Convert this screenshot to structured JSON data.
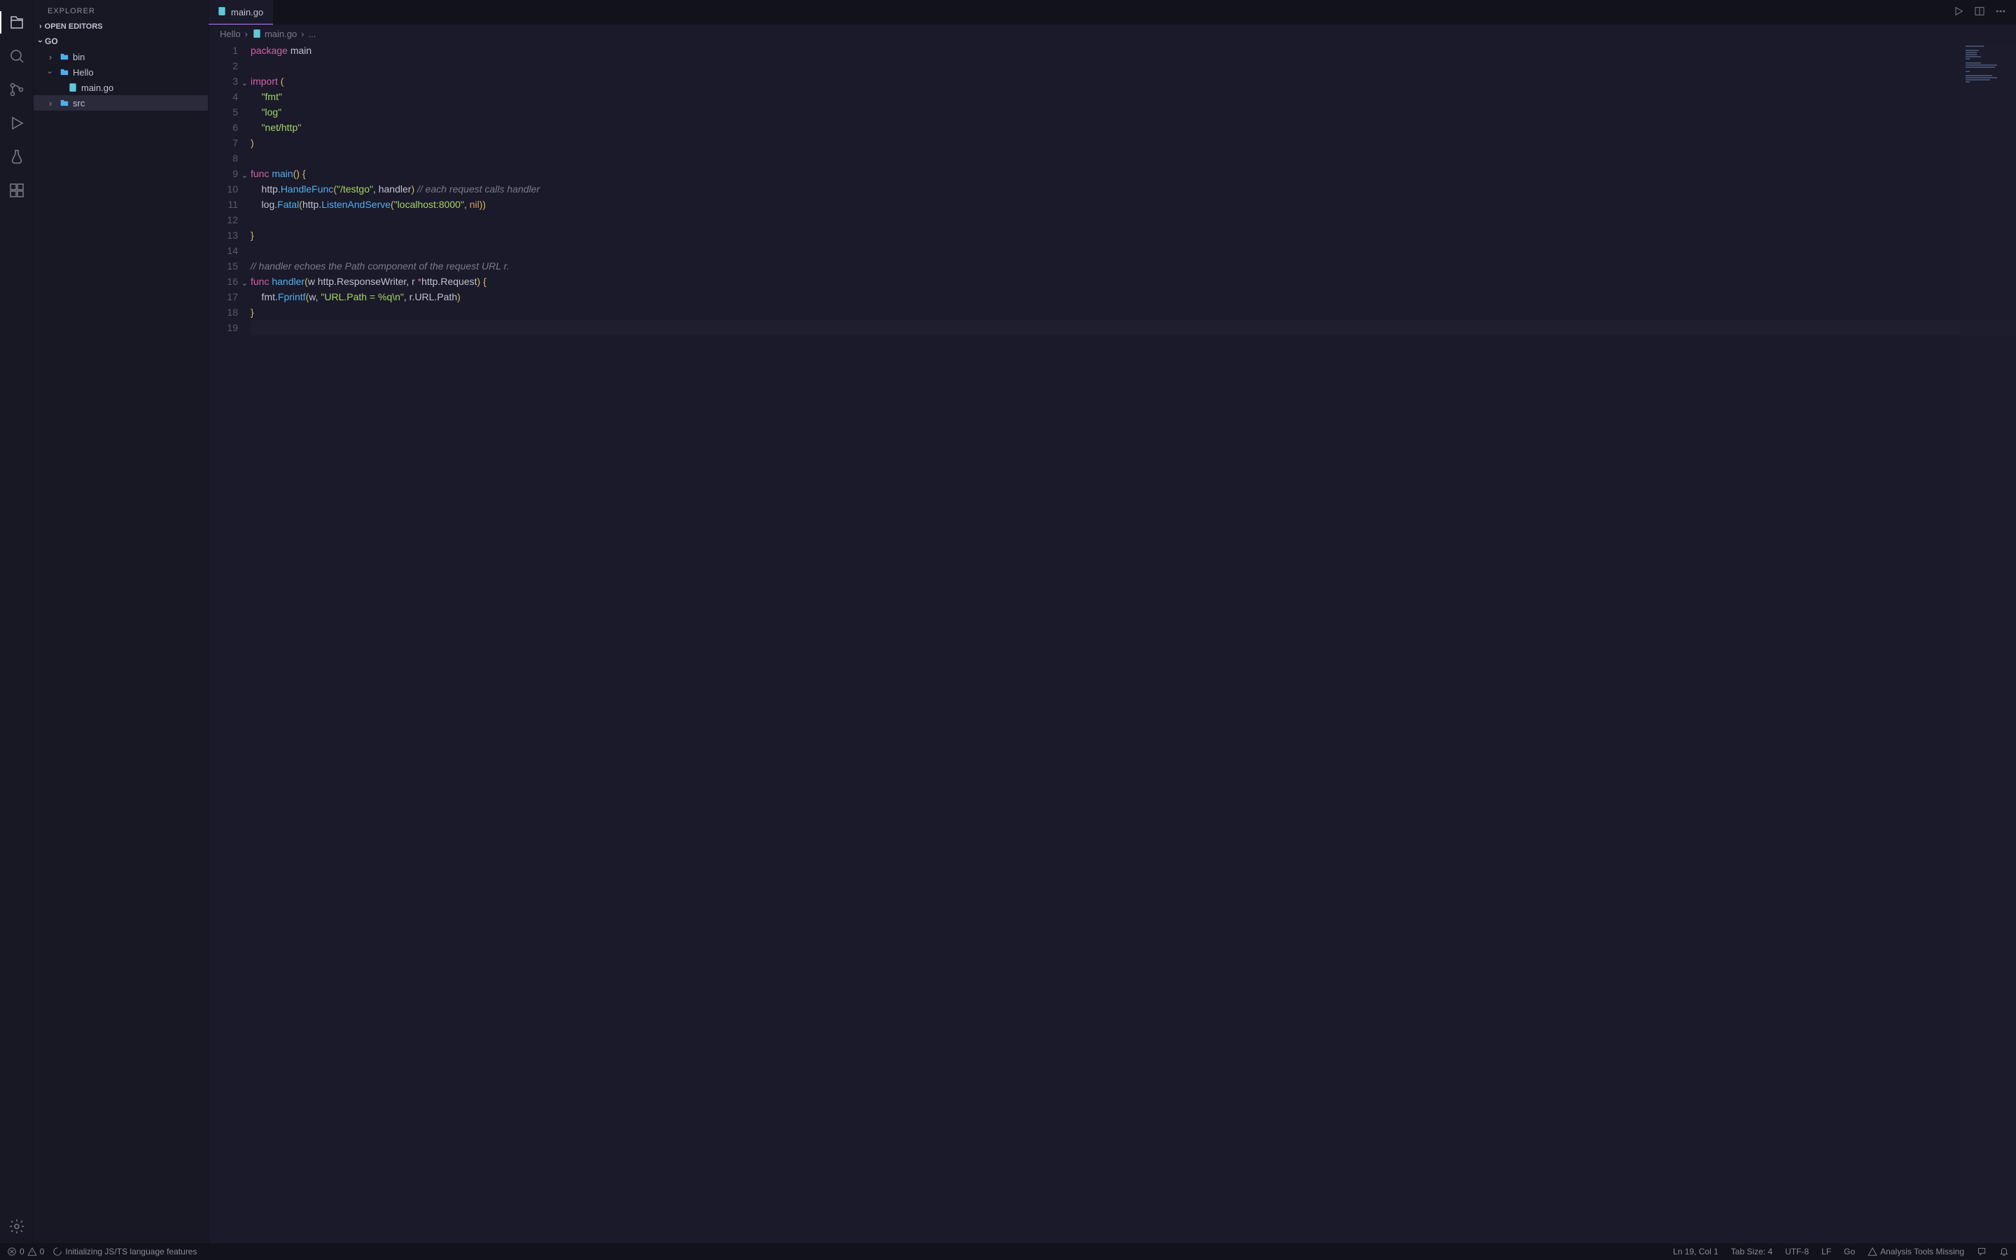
{
  "sidebar": {
    "title": "EXPLORER",
    "sections": {
      "open_editors": "OPEN EDITORS",
      "root": "GO"
    },
    "tree": [
      {
        "name": "bin",
        "type": "folder",
        "depth": 1,
        "expanded": false
      },
      {
        "name": "Hello",
        "type": "folder",
        "depth": 1,
        "expanded": true
      },
      {
        "name": "main.go",
        "type": "file",
        "depth": 2
      },
      {
        "name": "src",
        "type": "folder",
        "depth": 1,
        "expanded": false,
        "selected": true
      }
    ]
  },
  "tabs": {
    "active": "main.go"
  },
  "breadcrumbs": {
    "crumb1": "Hello",
    "crumb2": "main.go",
    "crumb3": "..."
  },
  "editor": {
    "lines": [
      {
        "n": 1,
        "tokens": [
          {
            "t": "package ",
            "c": "kw"
          },
          {
            "t": "main",
            "c": "pn"
          }
        ]
      },
      {
        "n": 2,
        "tokens": []
      },
      {
        "n": 3,
        "fold": true,
        "tokens": [
          {
            "t": "import ",
            "c": "kw"
          },
          {
            "t": "(",
            "c": "yl"
          }
        ]
      },
      {
        "n": 4,
        "tokens": [
          {
            "t": "    ",
            "c": ""
          },
          {
            "t": "\"fmt\"",
            "c": "str"
          }
        ]
      },
      {
        "n": 5,
        "tokens": [
          {
            "t": "    ",
            "c": ""
          },
          {
            "t": "\"log\"",
            "c": "str"
          }
        ]
      },
      {
        "n": 6,
        "tokens": [
          {
            "t": "    ",
            "c": ""
          },
          {
            "t": "\"net/http\"",
            "c": "str"
          }
        ]
      },
      {
        "n": 7,
        "tokens": [
          {
            "t": ")",
            "c": "yl"
          }
        ]
      },
      {
        "n": 8,
        "tokens": []
      },
      {
        "n": 9,
        "fold": true,
        "tokens": [
          {
            "t": "func ",
            "c": "kw"
          },
          {
            "t": "main",
            "c": "fn"
          },
          {
            "t": "()",
            "c": "yl"
          },
          {
            "t": " ",
            "c": ""
          },
          {
            "t": "{",
            "c": "yl"
          }
        ]
      },
      {
        "n": 10,
        "tokens": [
          {
            "t": "    http.",
            "c": "pn"
          },
          {
            "t": "HandleFunc",
            "c": "fn"
          },
          {
            "t": "(",
            "c": "yl"
          },
          {
            "t": "\"/testgo\"",
            "c": "str"
          },
          {
            "t": ", handler",
            "c": "pn"
          },
          {
            "t": ")",
            "c": "yl"
          },
          {
            "t": " ",
            "c": ""
          },
          {
            "t": "// each request calls handler",
            "c": "cmt"
          }
        ]
      },
      {
        "n": 11,
        "tokens": [
          {
            "t": "    log.",
            "c": "pn"
          },
          {
            "t": "Fatal",
            "c": "fn"
          },
          {
            "t": "(",
            "c": "yl"
          },
          {
            "t": "http.",
            "c": "pn"
          },
          {
            "t": "ListenAndServe",
            "c": "fn"
          },
          {
            "t": "(",
            "c": "yl"
          },
          {
            "t": "\"localhost:8000\"",
            "c": "str"
          },
          {
            "t": ", ",
            "c": "pn"
          },
          {
            "t": "nil",
            "c": "pk"
          },
          {
            "t": "))",
            "c": "yl"
          }
        ]
      },
      {
        "n": 12,
        "tokens": []
      },
      {
        "n": 13,
        "tokens": [
          {
            "t": "}",
            "c": "yl"
          }
        ]
      },
      {
        "n": 14,
        "tokens": []
      },
      {
        "n": 15,
        "tokens": [
          {
            "t": "// handler echoes the Path component of the request URL r.",
            "c": "cmt"
          }
        ]
      },
      {
        "n": 16,
        "fold": true,
        "tokens": [
          {
            "t": "func ",
            "c": "kw"
          },
          {
            "t": "handler",
            "c": "fn"
          },
          {
            "t": "(",
            "c": "yl"
          },
          {
            "t": "w http.ResponseWriter, r ",
            "c": "pn"
          },
          {
            "t": "*",
            "c": "kw"
          },
          {
            "t": "http.Request",
            "c": "pn"
          },
          {
            "t": ")",
            "c": "yl"
          },
          {
            "t": " ",
            "c": ""
          },
          {
            "t": "{",
            "c": "yl"
          }
        ]
      },
      {
        "n": 17,
        "tokens": [
          {
            "t": "    fmt.",
            "c": "pn"
          },
          {
            "t": "Fprintf",
            "c": "fn"
          },
          {
            "t": "(",
            "c": "yl"
          },
          {
            "t": "w, ",
            "c": "pn"
          },
          {
            "t": "\"URL.Path = %q\\n\"",
            "c": "str"
          },
          {
            "t": ", r.URL.Path",
            "c": "pn"
          },
          {
            "t": ")",
            "c": "yl"
          }
        ]
      },
      {
        "n": 18,
        "tokens": [
          {
            "t": "}",
            "c": "yl"
          }
        ]
      },
      {
        "n": 19,
        "current": true,
        "tokens": []
      }
    ]
  },
  "status": {
    "errors": "0",
    "warnings": "0",
    "task": "Initializing JS/TS language features",
    "ln_col": "Ln 19, Col 1",
    "tab_size": "Tab Size: 4",
    "encoding": "UTF-8",
    "eol": "LF",
    "language": "Go",
    "tools": "Analysis Tools Missing"
  }
}
